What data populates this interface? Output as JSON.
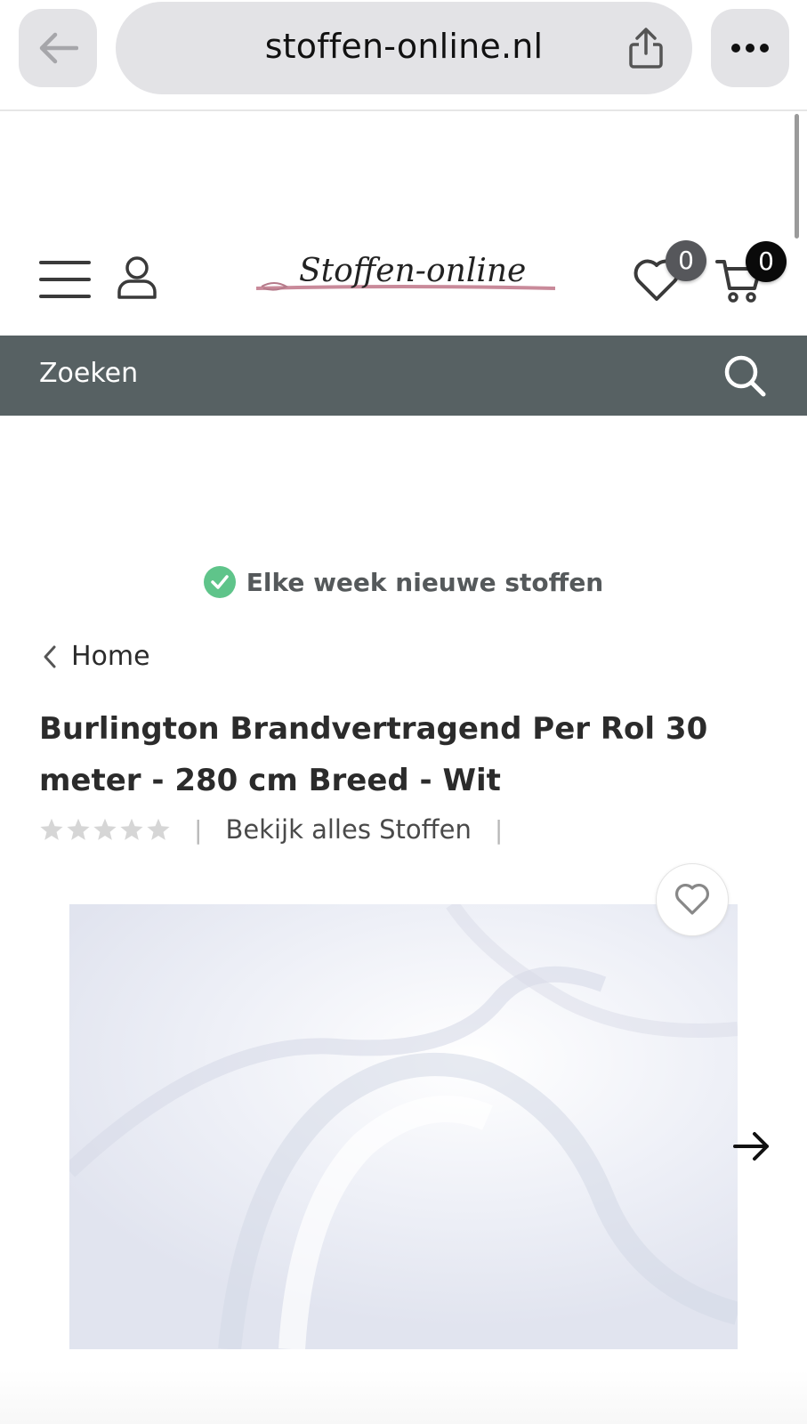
{
  "browser": {
    "url": "stoffen-online.nl"
  },
  "header": {
    "logo_text": "Stoffen-online",
    "wishlist_count": "0",
    "cart_count": "0"
  },
  "search": {
    "label": "Zoeken"
  },
  "usp": {
    "text": "Elke week nieuwe stoffen",
    "icon_color": "#5fc48a"
  },
  "breadcrumb": {
    "label": "Home"
  },
  "product": {
    "title": "Burlington Brandvertragend Per Rol 30 meter - 280 cm Breed - Wit",
    "rating_stars": 0,
    "rating_max": 5,
    "view_all_label": "Bekijk alles Stoffen",
    "separator": "|"
  },
  "colors": {
    "search_bar_bg": "#576163",
    "badge_wishlist": "#56575b",
    "badge_cart": "#0a0a0a"
  }
}
